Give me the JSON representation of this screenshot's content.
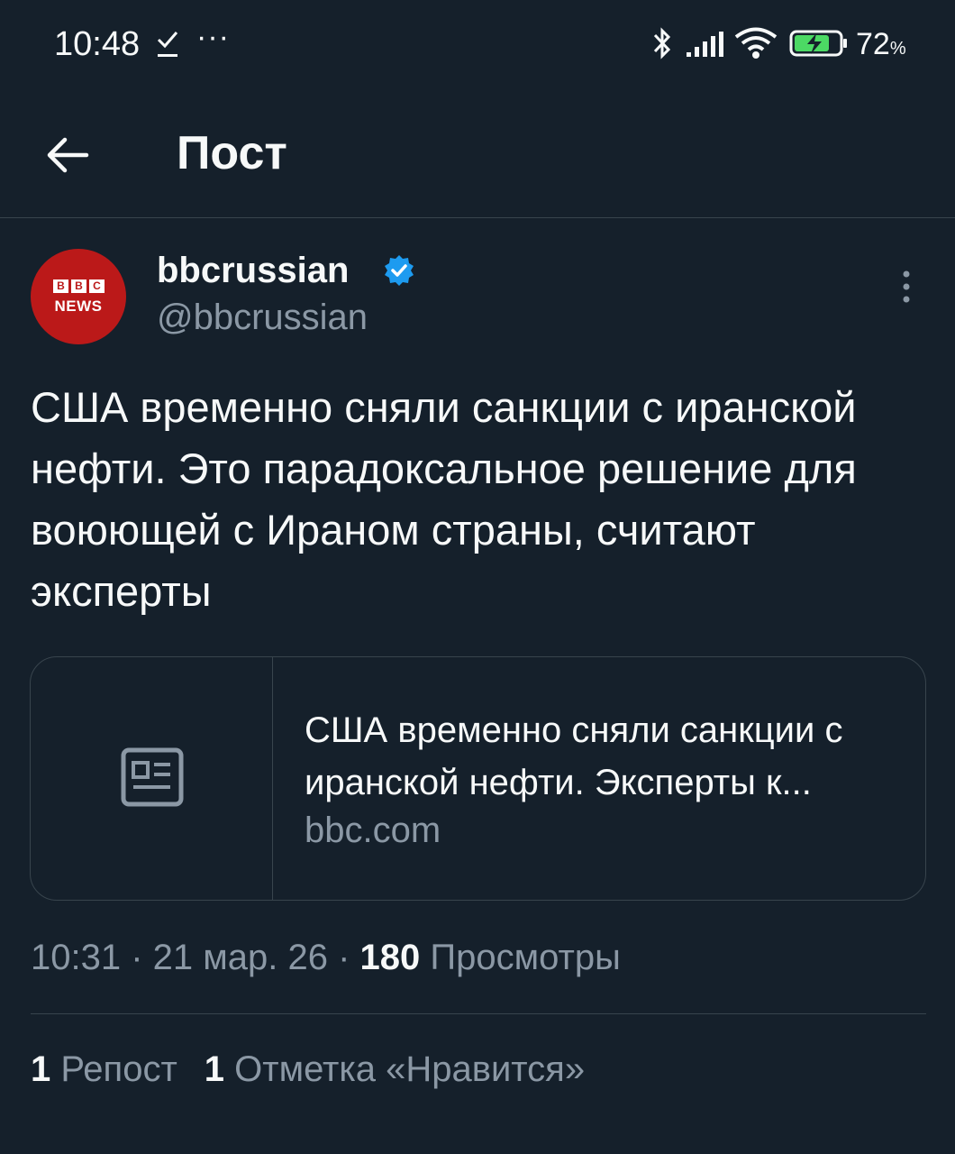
{
  "status_bar": {
    "time": "10:48",
    "dots": "···",
    "battery_percent": "72",
    "battery_unit": "%",
    "icons": [
      "download-done-icon",
      "bluetooth-icon",
      "signal-icon",
      "wifi-icon",
      "battery-charging-icon"
    ]
  },
  "header": {
    "title": "Пост"
  },
  "post": {
    "author_name": "bbcrussian",
    "author_handle": "@bbcrussian",
    "avatar_text_blocks": [
      "B",
      "B",
      "C"
    ],
    "avatar_news": "NEWS",
    "text": "США временно сняли санкции с иранской нефти. Это парадоксальное решение для воюющей с Ираном страны, считают эксперты",
    "card": {
      "title": "США временно сняли санкции с иранской нефти. Эксперты к...",
      "domain": "bbc.com"
    },
    "time": "10:31",
    "sep1": " · ",
    "date": "21 мар. 26",
    "sep2": " · ",
    "views_count": "180",
    "views_label": "Просмотры",
    "reposts_count": "1",
    "reposts_label": "Репост",
    "likes_count": "1",
    "likes_label": "Отметка «Нравится»"
  },
  "colors": {
    "background": "#15202b",
    "text_primary": "#f7f9f9",
    "text_secondary": "#8b98a5",
    "border": "#38444d",
    "verified": "#1d9bf0",
    "bbc_red": "#bb1919"
  }
}
